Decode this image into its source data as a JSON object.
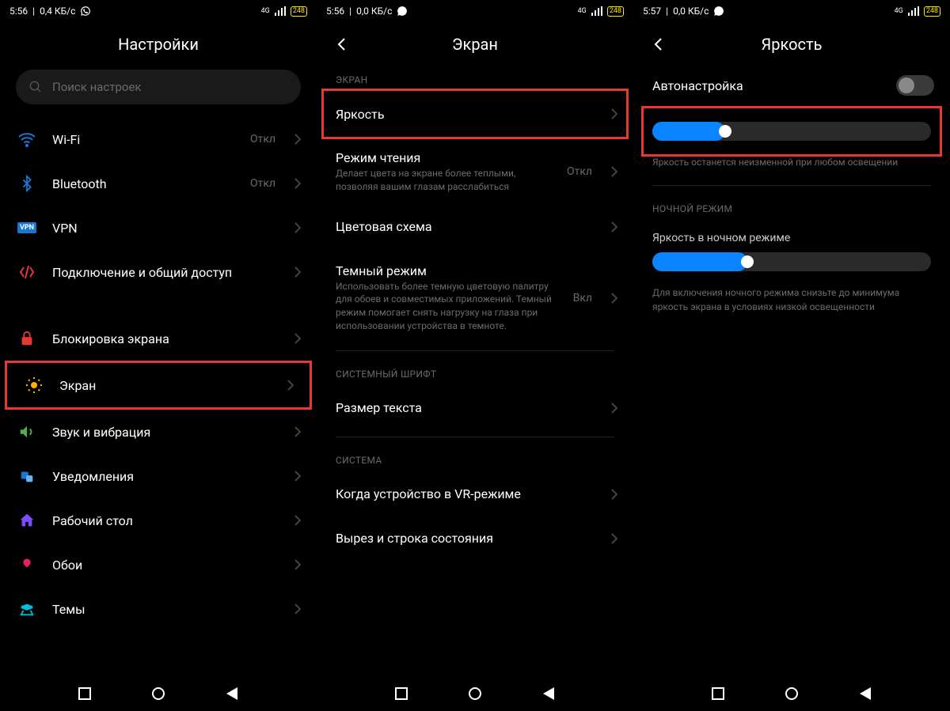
{
  "status": {
    "time1": "5:56",
    "speed1": "0,4 КБ/с",
    "time2": "5:56",
    "speed2": "0,0 КБ/с",
    "time3": "5:57",
    "speed3": "0,0 КБ/с",
    "net": "4G",
    "battery": "248"
  },
  "screen1": {
    "title": "Настройки",
    "search_placeholder": "Поиск настроек",
    "items": [
      {
        "label": "Wi-Fi",
        "value": "Откл"
      },
      {
        "label": "Bluetooth",
        "value": "Откл"
      },
      {
        "label": "VPN"
      },
      {
        "label": "Подключение и общий доступ"
      },
      {
        "label": "Блокировка экрана"
      },
      {
        "label": "Экран"
      },
      {
        "label": "Звук и вибрация"
      },
      {
        "label": "Уведомления"
      },
      {
        "label": "Рабочий стол"
      },
      {
        "label": "Обои"
      },
      {
        "label": "Темы"
      }
    ]
  },
  "screen2": {
    "title": "Экран",
    "sections": {
      "screen": "ЭКРАН",
      "font": "СИСТЕМНЫЙ ШРИФТ",
      "system": "СИСТЕМА"
    },
    "brightness": {
      "label": "Яркость"
    },
    "reading": {
      "label": "Режим чтения",
      "sub": "Делает цвета на экране более теплыми, позволяя вашим глазам расслабиться",
      "value": "Откл"
    },
    "color_scheme": {
      "label": "Цветовая схема"
    },
    "dark_mode": {
      "label": "Темный режим",
      "sub": "Использовать более темную цветовую палитру для обоев и совместимых приложений. Темный режим помогает снять нагрузку на глаза при использовании устройства в темноте.",
      "value": "Вкл"
    },
    "text_size": {
      "label": "Размер текста"
    },
    "vr": {
      "label": "Когда устройство в VR-режиме"
    },
    "notch": {
      "label": "Вырез и строка состояния"
    }
  },
  "screen3": {
    "title": "Яркость",
    "auto": {
      "label": "Автонастройка"
    },
    "caption1": "Яркость останется неизменной при любом освещении",
    "night_section": "НОЧНОЙ РЕЖИМ",
    "night_label": "Яркость в ночном режиме",
    "caption2": "Для включения ночного режима снизьте до минимума яркость экрана в условиях низкой освещенности",
    "slider1_percent": 26,
    "slider2_percent": 34
  }
}
